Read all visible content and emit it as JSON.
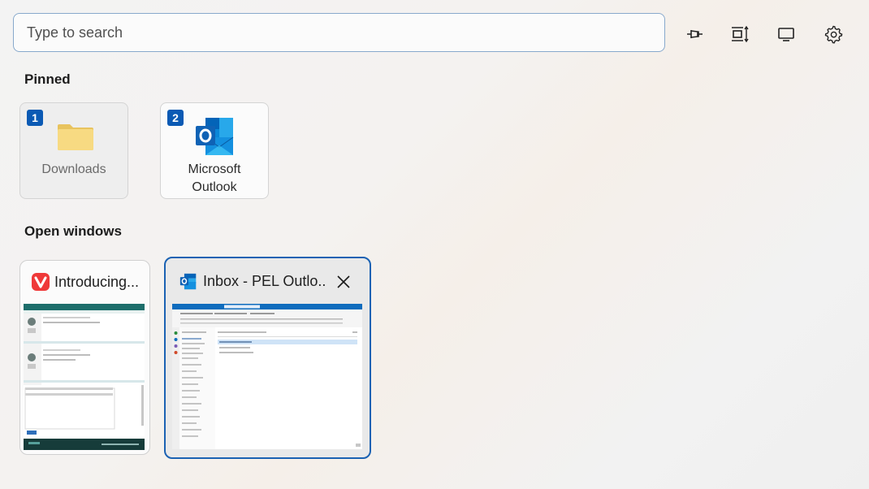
{
  "search": {
    "placeholder": "Type to search"
  },
  "toolbar": {
    "pin_icon": "pin-icon",
    "layout_icon": "layout-icon",
    "display_icon": "monitor-icon",
    "settings_icon": "gear-icon"
  },
  "pinned": {
    "title": "Pinned",
    "items": [
      {
        "badge": "1",
        "label": "Downloads",
        "icon": "folder-icon"
      },
      {
        "badge": "2",
        "label_line1": "Microsoft",
        "label_line2": "Outlook",
        "icon": "outlook-icon"
      }
    ]
  },
  "open_windows": {
    "title": "Open windows",
    "items": [
      {
        "title": "Introducing...",
        "icon": "vivaldi-icon"
      },
      {
        "title": "Inbox - PEL Outlo...",
        "icon": "outlook-icon",
        "close_icon": "close-icon"
      }
    ]
  },
  "colors": {
    "accent": "#0b5ab4",
    "selection_border": "#1b62b3",
    "search_border": "#88a9cc"
  }
}
